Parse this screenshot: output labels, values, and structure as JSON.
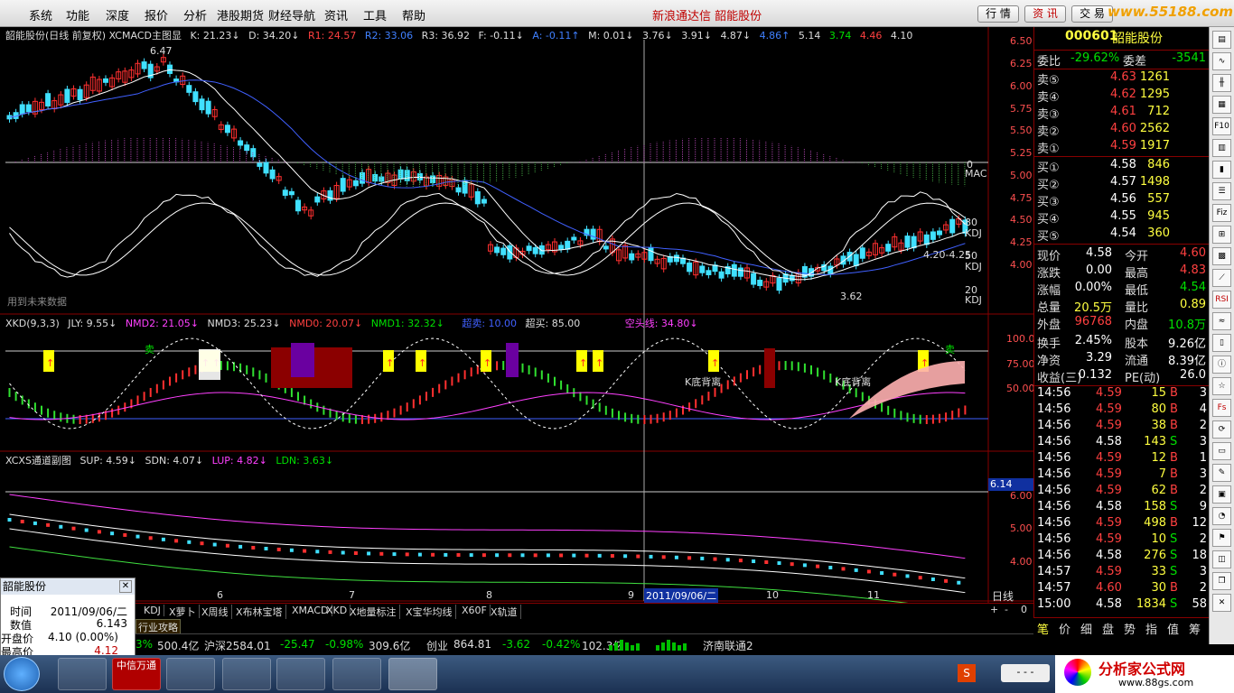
{
  "menu": {
    "items": [
      "系统",
      "功能",
      "深度",
      "报价",
      "分析",
      "港股期货",
      "财经导航",
      "资讯",
      "工具",
      "帮助"
    ],
    "app_title": "新浪通达信  韶能股份",
    "buttons": [
      "行 情",
      "资 讯",
      "交 易"
    ],
    "watermark": "www.55188.com"
  },
  "main_panel": {
    "header": [
      "韶能股份(日线 前复权) XCMACD主图显",
      "K: 21.23↓",
      "D: 34.20↓",
      "R1: 24.57",
      "R2: 33.06",
      "R3: 36.92",
      "F: -0.11↓",
      "A: -0.11↑",
      "M: 0.01↓",
      "3.76↓",
      "3.91↓",
      "4.87↓",
      "4.86↑",
      "5.14",
      "3.74",
      "4.46",
      "4.10"
    ],
    "axis": [
      "6.50",
      "6.25",
      "6.00",
      "5.75",
      "5.50",
      "5.25",
      "5.00",
      "4.75",
      "4.50",
      "4.25",
      "4.00"
    ],
    "high_label": "6.47",
    "low_label": "3.62",
    "range_label": "4.20-4.25",
    "mac_label": "MAC",
    "zero_label": "0",
    "kdj_labels": [
      "80",
      "KDJ",
      "50",
      "KDJ",
      "20",
      "KDJ"
    ],
    "future_text": "用到未来数据"
  },
  "xkd_panel": {
    "header": [
      "XKD(9,3,3)",
      "JLY: 9.55↓",
      "NMD2: 21.05↓",
      "NMD3: 25.23↓",
      "NMD0: 20.07↓",
      "NMD1: 32.32↓",
      "超卖: 10.00",
      "超买: 85.00",
      "空头线: 34.80↓"
    ],
    "axis": [
      "100.0",
      "75.00",
      "50.00"
    ],
    "annotations": [
      "K底背离",
      "K底背离",
      "卖",
      "卖"
    ]
  },
  "channel_panel": {
    "header": [
      "XCXS通道副图",
      "SUP: 4.59↓",
      "SDN: 4.07↓",
      "LUP: 4.82↓",
      "LDN: 3.63↓"
    ],
    "axis": [
      "6.00",
      "5.00",
      "4.00"
    ],
    "current": "6.14"
  },
  "dates": [
    "6",
    "7",
    "8",
    "9",
    "2011/09/06/二",
    "10",
    "11"
  ],
  "period_label": "日线",
  "tabs": [
    "KDJ",
    "X萝卜",
    "X周线",
    "X布林宝塔",
    "XMACD",
    "XKD",
    "X地量标注",
    "X宝华均线",
    "X60F",
    "X轨道"
  ],
  "tabs2": [
    "行业攻略"
  ],
  "ticker": {
    "items": [
      "3%",
      "500.4亿",
      "沪深2584.01",
      "-25.47",
      "-0.98%",
      "309.6亿",
      "创业",
      "864.81",
      "-3.62",
      "-0.42%",
      "102.3亿",
      "济南联通2"
    ]
  },
  "quote": {
    "code": "000601",
    "name": "韶能股份",
    "weibi_label": "委比",
    "weibi": "-29.62%",
    "weicha_label": "委差",
    "weicha": "-3541",
    "sell": [
      {
        "label": "卖⑤",
        "price": "4.63",
        "vol": "1261"
      },
      {
        "label": "卖④",
        "price": "4.62",
        "vol": "1295"
      },
      {
        "label": "卖③",
        "price": "4.61",
        "vol": "712"
      },
      {
        "label": "卖②",
        "price": "4.60",
        "vol": "2562"
      },
      {
        "label": "卖①",
        "price": "4.59",
        "vol": "1917"
      }
    ],
    "buy": [
      {
        "label": "买①",
        "price": "4.58",
        "vol": "846"
      },
      {
        "label": "买②",
        "price": "4.57",
        "vol": "1498"
      },
      {
        "label": "买③",
        "price": "4.56",
        "vol": "557"
      },
      {
        "label": "买④",
        "price": "4.55",
        "vol": "945"
      },
      {
        "label": "买⑤",
        "price": "4.54",
        "vol": "360"
      }
    ],
    "stats": [
      {
        "l1": "现价",
        "v1": "4.58",
        "l2": "今开",
        "v2": "4.60",
        "c1": "white",
        "c2": "red"
      },
      {
        "l1": "涨跌",
        "v1": "0.00",
        "l2": "最高",
        "v2": "4.83",
        "c1": "white",
        "c2": "red"
      },
      {
        "l1": "涨幅",
        "v1": "0.00%",
        "l2": "最低",
        "v2": "4.54",
        "c1": "white",
        "c2": "green"
      },
      {
        "l1": "总量",
        "v1": "20.5万",
        "l2": "量比",
        "v2": "0.89",
        "c1": "yellow",
        "c2": "yellow"
      },
      {
        "l1": "外盘",
        "v1": "96768",
        "l2": "内盘",
        "v2": "10.8万",
        "c1": "red",
        "c2": "green"
      },
      {
        "l1": "换手",
        "v1": "2.45%",
        "l2": "股本",
        "v2": "9.26亿",
        "c1": "white",
        "c2": "white"
      },
      {
        "l1": "净资",
        "v1": "3.29",
        "l2": "流通",
        "v2": "8.39亿",
        "c1": "white",
        "c2": "white"
      },
      {
        "l1": "收益(三)",
        "v1": "0.132",
        "l2": "PE(动)",
        "v2": "26.0",
        "c1": "white",
        "c2": "white"
      }
    ],
    "ticks": [
      {
        "t": "14:56",
        "p": "4.59",
        "v": "15",
        "s": "B",
        "n": "3"
      },
      {
        "t": "14:56",
        "p": "4.59",
        "v": "80",
        "s": "B",
        "n": "4"
      },
      {
        "t": "14:56",
        "p": "4.59",
        "v": "38",
        "s": "B",
        "n": "2"
      },
      {
        "t": "14:56",
        "p": "4.58",
        "v": "143",
        "s": "S",
        "n": "3"
      },
      {
        "t": "14:56",
        "p": "4.59",
        "v": "12",
        "s": "B",
        "n": "1"
      },
      {
        "t": "14:56",
        "p": "4.59",
        "v": "7",
        "s": "B",
        "n": "3"
      },
      {
        "t": "14:56",
        "p": "4.59",
        "v": "62",
        "s": "B",
        "n": "2"
      },
      {
        "t": "14:56",
        "p": "4.58",
        "v": "158",
        "s": "S",
        "n": "9"
      },
      {
        "t": "14:56",
        "p": "4.59",
        "v": "498",
        "s": "B",
        "n": "12"
      },
      {
        "t": "14:56",
        "p": "4.59",
        "v": "10",
        "s": "S",
        "n": "2"
      },
      {
        "t": "14:56",
        "p": "4.58",
        "v": "276",
        "s": "S",
        "n": "18"
      },
      {
        "t": "14:57",
        "p": "4.59",
        "v": "33",
        "s": "S",
        "n": "3"
      },
      {
        "t": "14:57",
        "p": "4.60",
        "v": "30",
        "s": "B",
        "n": "2"
      },
      {
        "t": "15:00",
        "p": "4.58",
        "v": "1834",
        "s": "S",
        "n": "58"
      }
    ],
    "bottom_tabs": [
      "笔",
      "价",
      "细",
      "盘",
      "势",
      "指",
      "值",
      "筹"
    ]
  },
  "right_toolbar": [
    "RSI",
    "Fs"
  ],
  "popup": {
    "title": "韶能股份",
    "rows": [
      {
        "label": "时间",
        "value": "2011/09/06/二"
      },
      {
        "label": "数值",
        "value": "6.143"
      },
      {
        "label": "开盘价",
        "value": "4.10 (0.00%)"
      },
      {
        "label": "最高价",
        "value": "4.12"
      }
    ]
  },
  "taskbar": {
    "brand": "分析家公式网",
    "brand_url": "www.88gs.com",
    "app1": "中信万通"
  }
}
